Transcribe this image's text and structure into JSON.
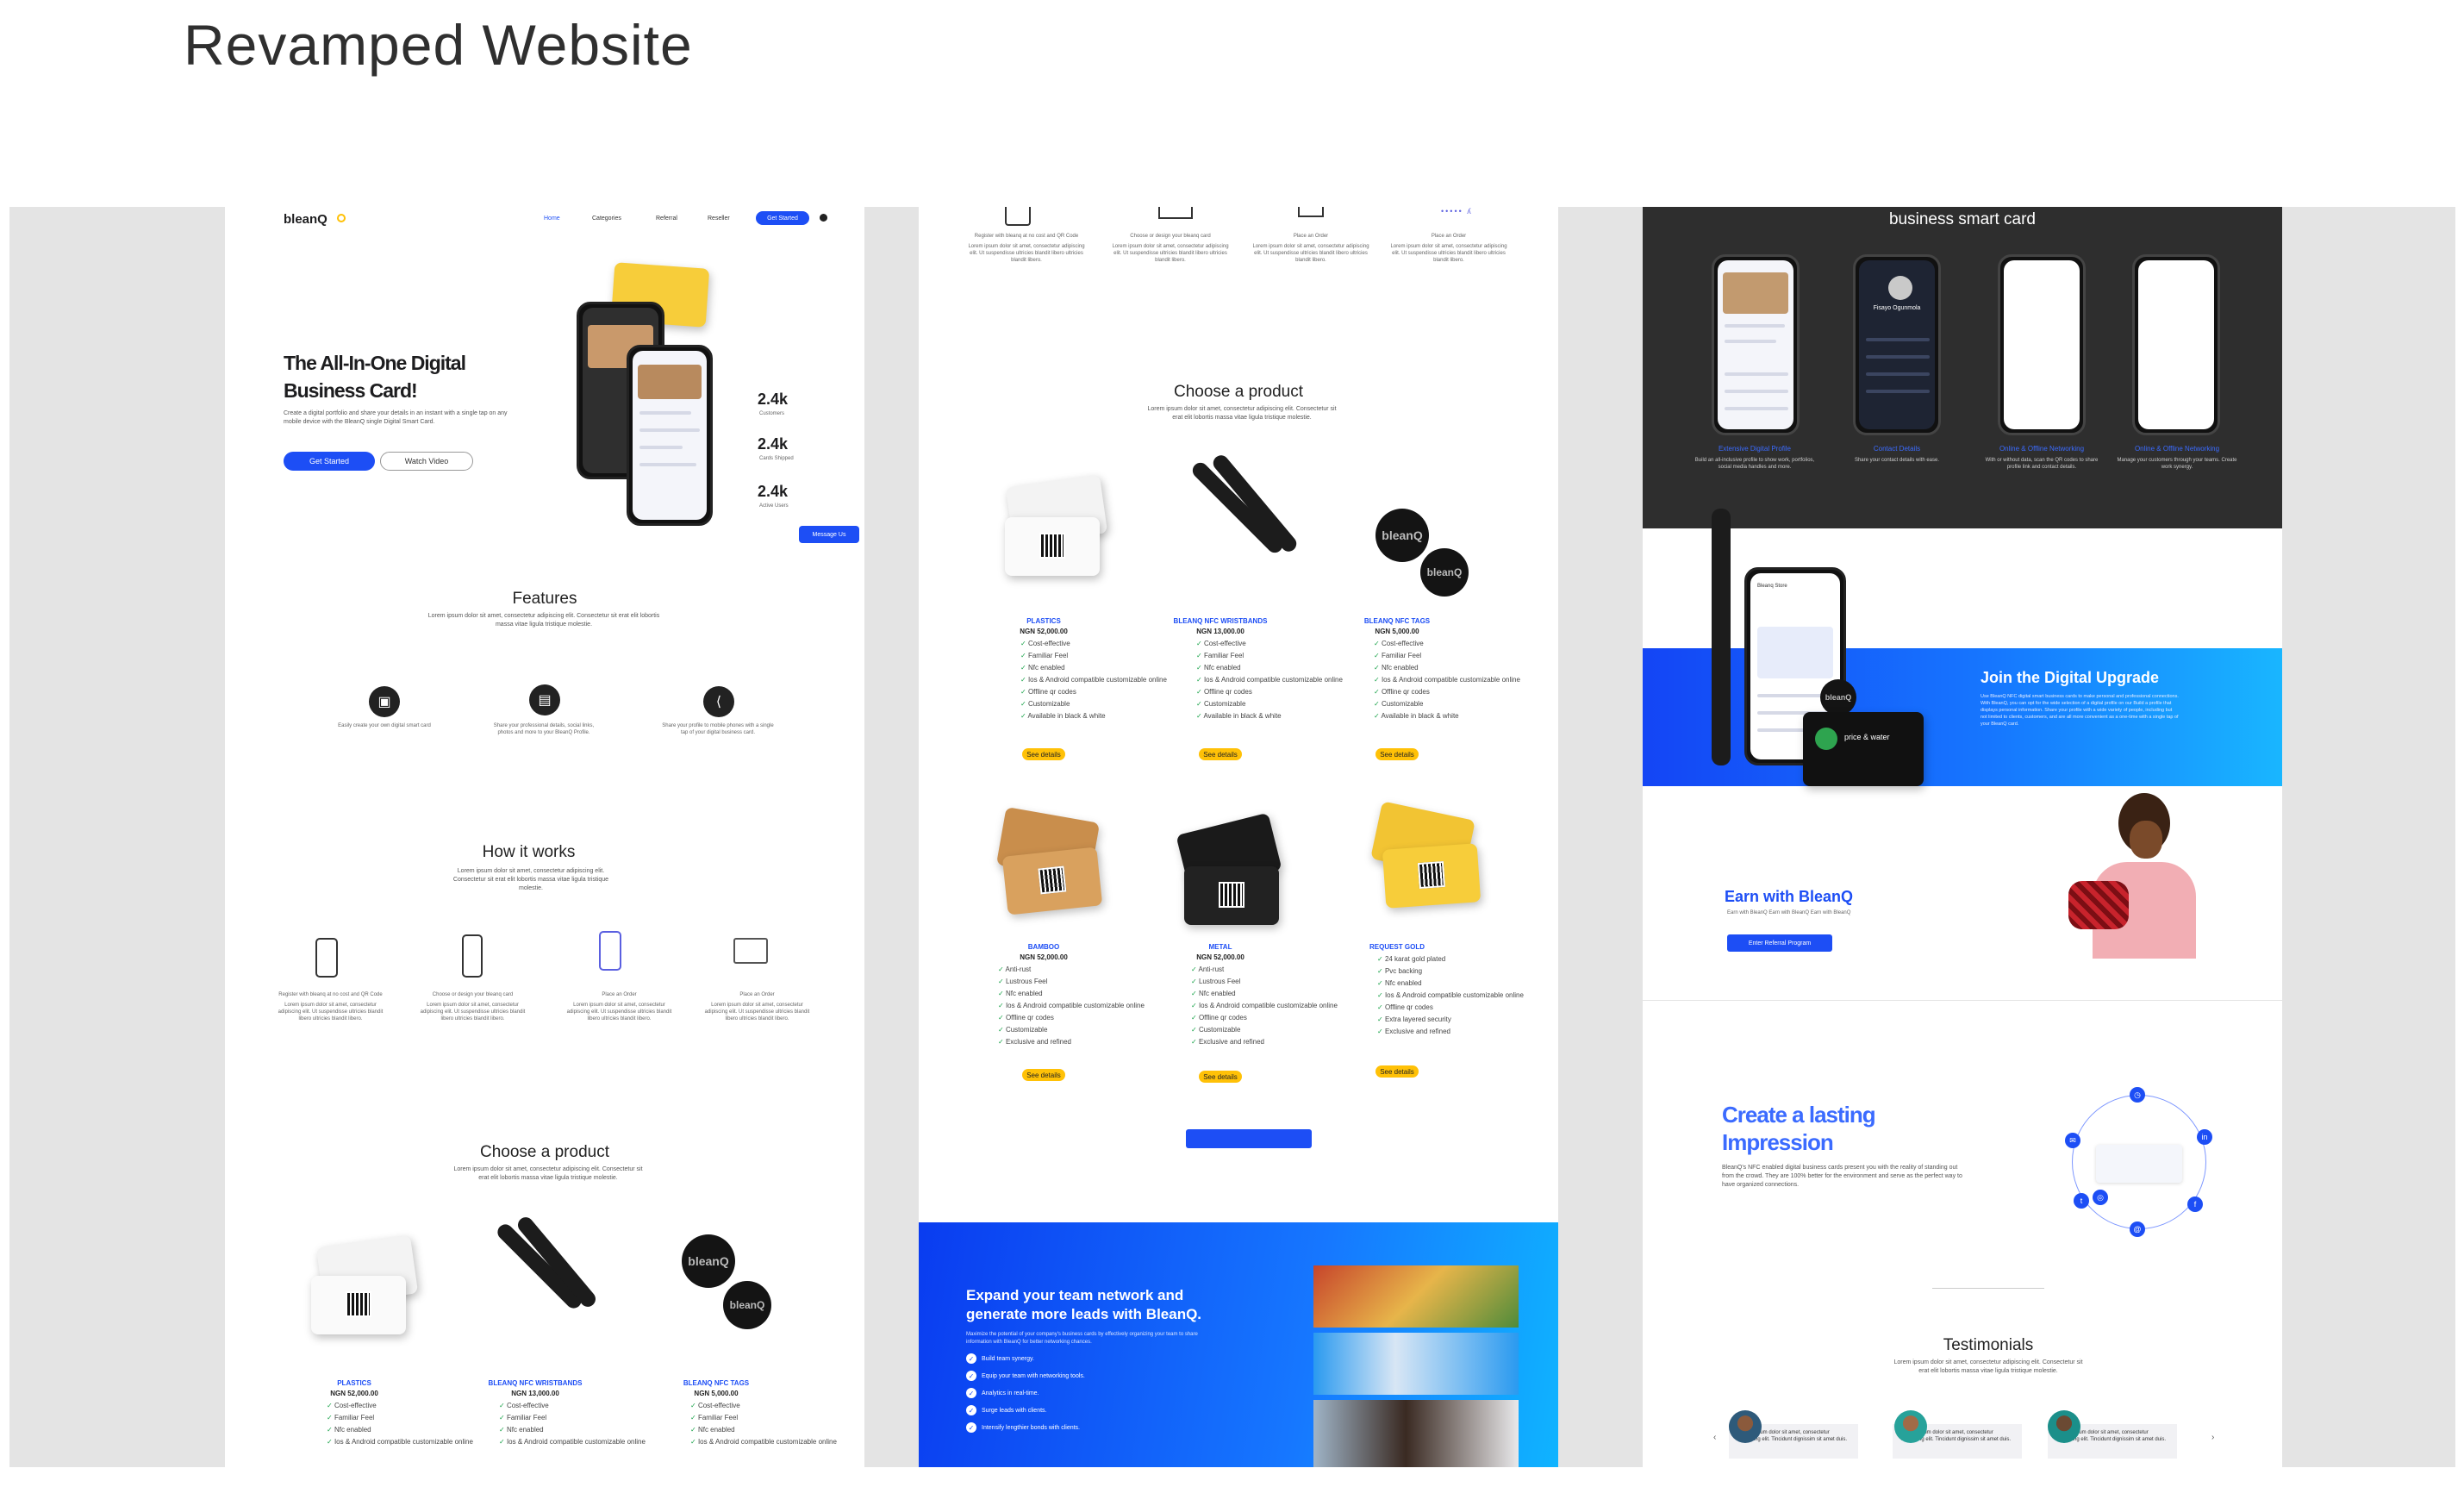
{
  "page_title": "Revamped Website",
  "p1": {
    "logo": "bleanQ",
    "nav": [
      "Home",
      "Categories",
      "Referral",
      "Reseller"
    ],
    "nav_cta": "Get Started",
    "hero_title_1": "The All-In-One Digital",
    "hero_title_2": "Business Card!",
    "hero_text": "Create a digital portfolio and share your details in an instant with a single tap on any mobile device with the BleanQ single Digital Smart Card.",
    "get_started": "Get Started",
    "watch_video": "Watch Video",
    "stats": [
      {
        "value": "2.4k",
        "label": "Customers"
      },
      {
        "value": "2.4k",
        "label": "Cards Shipped"
      },
      {
        "value": "2.4k",
        "label": "Active Users"
      }
    ],
    "message_us": "Message Us",
    "features_title": "Features",
    "features_text": "Lorem ipsum dolor sit amet, consectetur adipiscing elit. Consectetur sit erat elit lobortis massa vitae ligula tristique molestie.",
    "features": [
      "Easily create your own digital smart card",
      "Share your professional details, social links, photos and more to your BleanQ Profile.",
      "Share your profile to mobile phones with a single tap of your digital business card."
    ],
    "how_title": "How it works",
    "how_text": "Lorem ipsum dolor sit amet, consectetur adipiscing elit. Consectetur sit erat elit lobortis massa vitae ligula tristique molestie.",
    "steps": [
      {
        "label": "Register with bleanq at no cost and QR Code",
        "text": "Lorem ipsum dolor sit amet, consectetur adipiscing elit. Ut suspendisse ultricies blandit libero ultricies blandit libero."
      },
      {
        "label": "Choose or design your bleanq card",
        "text": "Lorem ipsum dolor sit amet, consectetur adipiscing elit. Ut suspendisse ultricies blandit libero ultricies blandit libero."
      },
      {
        "label": "Place an Order",
        "text": "Lorem ipsum dolor sit amet, consectetur adipiscing elit. Ut suspendisse ultricies blandit libero ultricies blandit libero."
      },
      {
        "label": "Place an Order",
        "text": "Lorem ipsum dolor sit amet, consectetur adipiscing elit. Ut suspendisse ultricies blandit libero ultricies blandit libero."
      }
    ],
    "choose_title": "Choose a product",
    "choose_text": "Lorem ipsum dolor sit amet, consectetur adipiscing elit. Consectetur sit erat elit lobortis massa vitae ligula tristique molestie.",
    "products": [
      {
        "name": "PLASTICS",
        "price": "NGN 52,000.00",
        "features": [
          "Cost-effective",
          "Familiar Feel",
          "Nfc enabled",
          "Ios & Android compatible customizable online"
        ]
      },
      {
        "name": "BLEANQ NFC WRISTBANDS",
        "price": "NGN 13,000.00",
        "features": [
          "Cost-effective",
          "Familiar Feel",
          "Nfc enabled",
          "Ios & Android compatible customizable online"
        ]
      },
      {
        "name": "BLEANQ NFC TAGS",
        "price": "NGN 5,000.00",
        "features": [
          "Cost-effective",
          "Familiar Feel",
          "Nfc enabled",
          "Ios & Android compatible customizable online"
        ]
      }
    ]
  },
  "p2": {
    "steps": [
      {
        "label": "Register with bleanq at no cost and QR Code",
        "text": "Lorem ipsum dolor sit amet, consectetur adipiscing elit. Ut suspendisse ultricies blandit libero ultricies blandit libero."
      },
      {
        "label": "Choose or design your bleanq card",
        "text": "Lorem ipsum dolor sit amet, consectetur adipiscing elit. Ut suspendisse ultricies blandit libero ultricies blandit libero."
      },
      {
        "label": "Place an Order",
        "text": "Lorem ipsum dolor sit amet, consectetur adipiscing elit. Ut suspendisse ultricies blandit libero ultricies blandit libero."
      },
      {
        "label": "Place an Order",
        "text": "Lorem ipsum dolor sit amet, consectetur adipiscing elit. Ut suspendisse ultricies blandit libero ultricies blandit libero."
      }
    ],
    "choose_title": "Choose a product",
    "choose_text": "Lorem ipsum dolor sit amet, consectetur adipiscing elit. Consectetur sit erat elit lobortis massa vitae ligula tristique molestie.",
    "products_row1": [
      {
        "name": "PLASTICS",
        "price": "NGN 52,000.00",
        "features": [
          "Cost-effective",
          "Familiar Feel",
          "Nfc enabled",
          "Ios & Android compatible customizable online",
          "Offline qr codes",
          "Customizable",
          "Available in black & white"
        ]
      },
      {
        "name": "BLEANQ NFC WRISTBANDS",
        "price": "NGN 13,000.00",
        "features": [
          "Cost-effective",
          "Familiar Feel",
          "Nfc enabled",
          "Ios & Android compatible customizable online",
          "Offline qr codes",
          "Customizable",
          "Available in black & white"
        ]
      },
      {
        "name": "BLEANQ NFC TAGS",
        "price": "NGN 5,000.00",
        "features": [
          "Cost-effective",
          "Familiar Feel",
          "Nfc enabled",
          "Ios & Android compatible customizable online",
          "Offline qr codes",
          "Customizable",
          "Available in black & white"
        ]
      }
    ],
    "products_row2": [
      {
        "name": "BAMBOO",
        "price": "NGN 52,000.00",
        "features": [
          "Anti-rust",
          "Lustrous Feel",
          "Nfc enabled",
          "Ios & Android compatible customizable online",
          "Offline qr codes",
          "Customizable",
          "Exclusive and refined"
        ]
      },
      {
        "name": "METAL",
        "price": "NGN 52,000.00",
        "features": [
          "Anti-rust",
          "Lustrous Feel",
          "Nfc enabled",
          "Ios & Android compatible customizable online",
          "Offline qr codes",
          "Customizable",
          "Exclusive and refined"
        ]
      },
      {
        "name": "REQUEST GOLD",
        "price": "",
        "features": [
          "24 karat gold plated",
          "Pvc backing",
          "Nfc enabled",
          "Ios & Android compatible customizable online",
          "Offline qr codes",
          "Extra layered security",
          "Exclusive and refined"
        ]
      }
    ],
    "see_details": "See details",
    "expand_title": "Expand your team network and generate more leads with BleanQ.",
    "expand_text": "Maximize the potential of your company's business cards by effectively organizing your team to share information with BleanQ for better networking chances.",
    "expand_items": [
      "Build team synergy.",
      "Equip your team with networking tools.",
      "Analytics in real-time.",
      "Surge leads with clients.",
      "Intensify lengthier bonds with clients."
    ]
  },
  "p3": {
    "smart_title": "business smart card",
    "profile_name": "Fisayo Ogunmola",
    "phone_features": [
      {
        "title": "Extensive Digital Profile",
        "text": "Build an all-inclusive profile to show work, portfolios, social media handles and more."
      },
      {
        "title": "Contact Details",
        "text": "Share your contact details with ease."
      },
      {
        "title": "Online & Offline Networking",
        "text": "With or without data, scan the QR codes to share profile link and contact details."
      },
      {
        "title": "Online & Offline Networking",
        "text": "Manage your customers through your teams. Create work synergy."
      }
    ],
    "join_title": "Join the Digital Upgrade",
    "join_text": "Use BleanQ NFC digital smart business cards to make personal and professional connections. With BleanQ, you can opt for the wide selection of a digital profile on our Build a profile that displays personal information. Share your profile with a wide variety of people, including but not limited to clients, customers, and are all more convenient as a one-time with a single tap of your BleanQ card.",
    "store_label": "Bleanq Store",
    "card_brand": "price & water",
    "earn_title": "Earn with BleanQ",
    "earn_text": "Earn with BleanQ Earn with BleanQ Earn with BleanQ",
    "earn_btn": "Enter Referral Program",
    "impression_title_1": "Create a lasting",
    "impression_title_2": "Impression",
    "impression_text": "BleanQ's NFC enabled digital business cards present you with the reality of standing out from the crowd. They are 100% better for the environment and serve as the perfect way to have organized connections.",
    "testimonials_title": "Testimonials",
    "testimonials_text": "Lorem ipsum dolor sit amet, consectetur adipiscing elit. Consectetur sit erat elit lobortis massa vitae ligula tristique molestie.",
    "testimonials": [
      "Lorem ipsum dolor sit amet, consectetur adipiscing elit. Tincidunt dignissim sit amet duis.",
      "Lorem ipsum dolor sit amet, consectetur adipiscing elit. Tincidunt dignissim sit amet duis.",
      "Lorem ipsum dolor sit amet, consectetur adipiscing elit. Tincidunt dignissim sit amet duis."
    ]
  },
  "colors": {
    "brand_blue": "#1d4ef5",
    "accent_yellow": "#ffc107",
    "dark": "#2e2e2e"
  }
}
